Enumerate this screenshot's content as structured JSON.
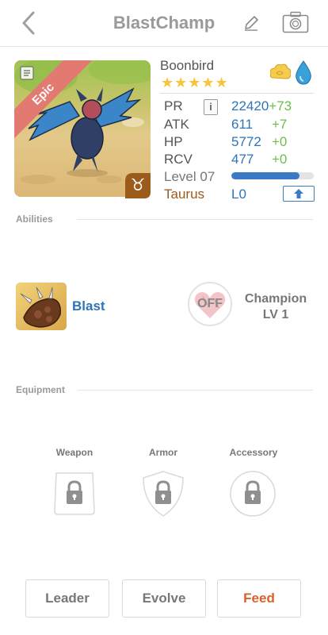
{
  "header": {
    "title": "BlastChamp"
  },
  "card": {
    "rarity": "Epic",
    "name": "Boonbird",
    "stars": "★★★★★",
    "zodiac_symbol": "♉"
  },
  "stats": [
    {
      "label": "PR",
      "value": "22420",
      "bonus": "+73"
    },
    {
      "label": "ATK",
      "value": "611",
      "bonus": "+7"
    },
    {
      "label": "HP",
      "value": "5772",
      "bonus": "+0"
    },
    {
      "label": "RCV",
      "value": "477",
      "bonus": "+0"
    }
  ],
  "level": {
    "label": "Level 07",
    "progress": 0.83
  },
  "zodiac": {
    "name": "Taurus",
    "level": "L0"
  },
  "info_button": "i",
  "abilities": {
    "section_label": "Abilities",
    "skill_name": "Blast",
    "toggle": "OFF",
    "champion_title": "Champion",
    "champion_level": "LV 1"
  },
  "equipment": {
    "section_label": "Equipment",
    "slots": [
      {
        "label": "Weapon"
      },
      {
        "label": "Armor"
      },
      {
        "label": "Accessory"
      }
    ]
  },
  "buttons": {
    "leader": "Leader",
    "evolve": "Evolve",
    "feed": "Feed"
  },
  "colors": {
    "accent_blue": "#2e74b6",
    "bonus_green": "#6cbf4a",
    "feed_orange": "#d9602a",
    "zodiac_brown": "#9a5b1b",
    "star_yellow": "#f7c43b",
    "epic_ribbon": "#e37a72"
  }
}
